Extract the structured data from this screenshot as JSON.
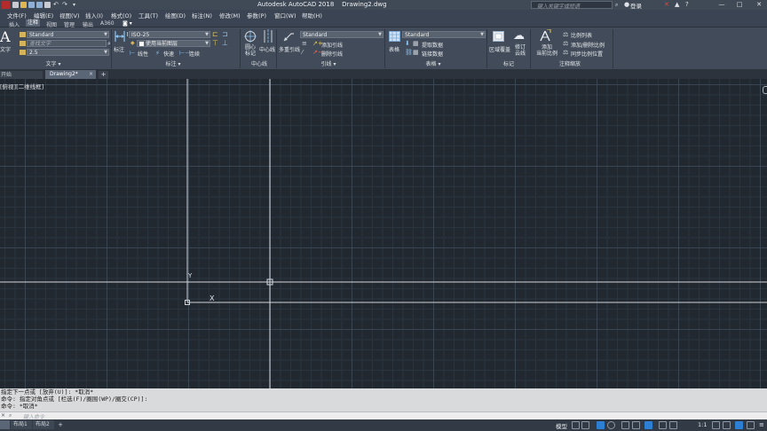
{
  "app": {
    "title": "Autodesk AutoCAD 2018    Drawing2.dwg",
    "search_placeholder": "键入关键字或短语",
    "user_label": "登录"
  },
  "menubar": [
    "文件(F)",
    "编辑(E)",
    "视图(V)",
    "插入(I)",
    "格式(O)",
    "工具(T)",
    "绘图(D)",
    "标注(N)",
    "修改(M)",
    "参数(P)",
    "窗口(W)",
    "帮助(H)"
  ],
  "ribbon_tabs": [
    "插入",
    "注释",
    "视图",
    "管理",
    "输出",
    "A360"
  ],
  "ribbon_active_tab": "注释",
  "ribbon": {
    "text_panel": {
      "big_button": "文字",
      "text_style": "Standard",
      "find_placeholder": "查找文字",
      "height": "2.5",
      "title": "文字"
    },
    "dim_panel": {
      "big_button": "标注",
      "dim_style": "ISO-25",
      "layer": "使用当前图层",
      "linear": "线性",
      "quick": "快速",
      "continue": "连续",
      "title": "标注"
    },
    "centerline_panel": {
      "center_mark": "圆心\n标记",
      "centerline": "中心线",
      "title": "中心线"
    },
    "leader_panel": {
      "multileader": "多重引线",
      "style": "Standard",
      "add": "添加引线",
      "remove": "删除引线",
      "title": "引线"
    },
    "table_panel": {
      "table": "表格",
      "style": "Standard",
      "extract": "提取数据",
      "link": "链接数据",
      "title": "表格"
    },
    "markup_panel": {
      "wipeout": "区域覆盖",
      "revcloud": "修订\n云线",
      "title": "标记"
    },
    "scale_panel": {
      "add_current": "添加\n当前比例",
      "scale_list": "比例列表",
      "add_delete": "添加/删除比例",
      "sync": "同步比例位置",
      "title": "注释缩放"
    }
  },
  "doc_tabs": {
    "start": "开始",
    "active": "Drawing2*",
    "plus": "+"
  },
  "viewport_label": "[俯视][二维线框]",
  "ucs": {
    "y_label": "Y",
    "x_label": "X"
  },
  "command_history": [
    "指定下一点或 [放弃(U)]: *取消*",
    "命令: 指定对角点或 [栏选(F)/圈围(WP)/圈交(CP)]:",
    "命令: *取消*"
  ],
  "command_input_placeholder": "键入命令",
  "layout_tabs": [
    "模型",
    "布局1",
    "布局2"
  ],
  "status": {
    "model_label": "模型",
    "scale": "1:1"
  },
  "colors": {
    "canvas_bg": "#212830",
    "ribbon_bg": "#414b59",
    "crosshair": "#d6d9dd",
    "status_highlight": "#2d7fd3"
  }
}
